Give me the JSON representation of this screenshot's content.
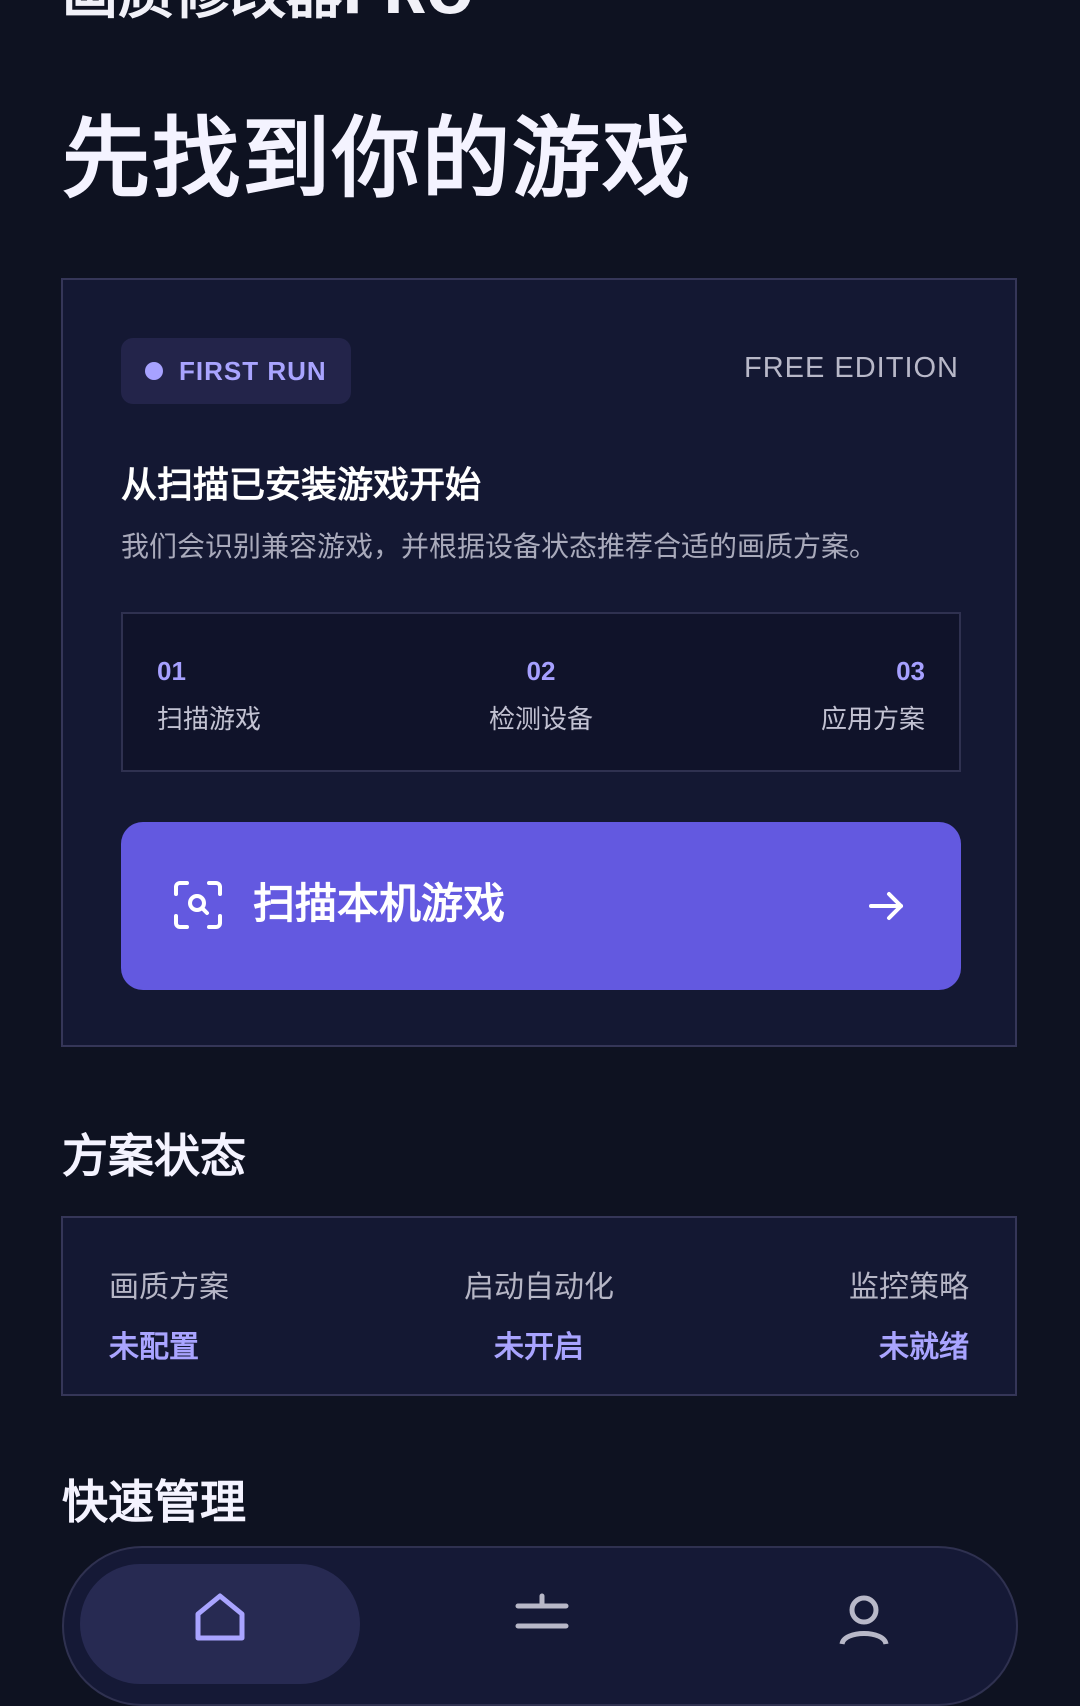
{
  "app": {
    "title": "画质修改器PRO"
  },
  "hero": {
    "title": "先找到你的游戏"
  },
  "first_run_card": {
    "badge": "FIRST RUN",
    "edition": "FREE EDITION",
    "heading": "从扫描已安装游戏开始",
    "description": "我们会识别兼容游戏，并根据设备状态推荐合适的画质方案。",
    "steps": [
      {
        "number": "01",
        "label": "扫描游戏"
      },
      {
        "number": "02",
        "label": "检测设备"
      },
      {
        "number": "03",
        "label": "应用方案"
      }
    ],
    "scan_button": {
      "label": "扫描本机游戏",
      "icon": "scan-search-icon",
      "trailing_icon": "arrow-right-icon"
    }
  },
  "status_section": {
    "title": "方案状态",
    "items": [
      {
        "label": "画质方案",
        "value": "未配置"
      },
      {
        "label": "启动自动化",
        "value": "未开启"
      },
      {
        "label": "监控策略",
        "value": "未就绪"
      }
    ]
  },
  "quick_section": {
    "title": "快速管理"
  },
  "bottom_nav": {
    "items": [
      {
        "icon": "home-icon",
        "active": true
      },
      {
        "icon": "sliders-icon",
        "active": false
      },
      {
        "icon": "user-icon",
        "active": false
      }
    ]
  },
  "colors": {
    "background": "#0e1221",
    "card": "#141833",
    "card_border": "#353658",
    "accent": "#6359e0",
    "accent_text": "#a9a4ff"
  }
}
